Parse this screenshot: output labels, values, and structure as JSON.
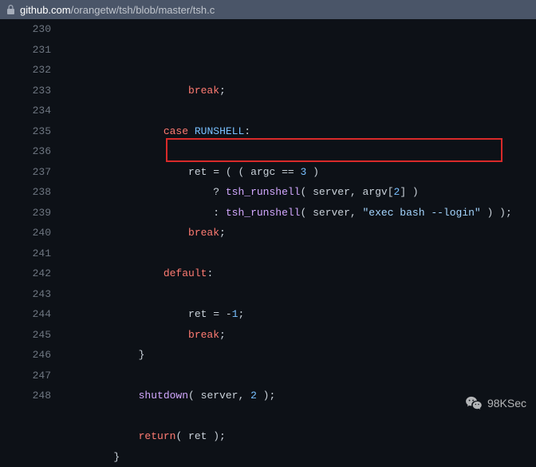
{
  "url": {
    "host": "github.com",
    "path": "/orangetw/tsh/blob/master/tsh.c"
  },
  "watermark": {
    "label": "98KSec"
  },
  "gutter": {
    "start": 230,
    "end": 248
  },
  "code": {
    "lines": [
      {
        "n": 230,
        "indent": 20,
        "tokens": [
          {
            "t": "kw",
            "v": "break"
          },
          {
            "t": "punct",
            "v": ";"
          }
        ]
      },
      {
        "n": 231,
        "indent": 0,
        "tokens": []
      },
      {
        "n": 232,
        "indent": 16,
        "tokens": [
          {
            "t": "kw",
            "v": "case"
          },
          {
            "t": "txt",
            "v": " "
          },
          {
            "t": "const",
            "v": "RUNSHELL"
          },
          {
            "t": "punct",
            "v": ":"
          }
        ]
      },
      {
        "n": 233,
        "indent": 0,
        "tokens": []
      },
      {
        "n": 234,
        "indent": 20,
        "tokens": [
          {
            "t": "txt",
            "v": "ret "
          },
          {
            "t": "op",
            "v": "="
          },
          {
            "t": "txt",
            "v": " ( ( argc "
          },
          {
            "t": "op",
            "v": "=="
          },
          {
            "t": "txt",
            "v": " "
          },
          {
            "t": "num",
            "v": "3"
          },
          {
            "t": "txt",
            "v": " )"
          }
        ]
      },
      {
        "n": 235,
        "indent": 24,
        "tokens": [
          {
            "t": "op",
            "v": "?"
          },
          {
            "t": "txt",
            "v": " "
          },
          {
            "t": "fn",
            "v": "tsh_runshell"
          },
          {
            "t": "txt",
            "v": "( server, argv["
          },
          {
            "t": "num",
            "v": "2"
          },
          {
            "t": "txt",
            "v": "] )"
          }
        ]
      },
      {
        "n": 236,
        "indent": 24,
        "tokens": [
          {
            "t": "op",
            "v": ":"
          },
          {
            "t": "txt",
            "v": " "
          },
          {
            "t": "fn",
            "v": "tsh_runshell"
          },
          {
            "t": "txt",
            "v": "( server, "
          },
          {
            "t": "str",
            "v": "\"exec bash --login\""
          },
          {
            "t": "txt",
            "v": " ) );"
          }
        ]
      },
      {
        "n": 237,
        "indent": 20,
        "tokens": [
          {
            "t": "kw",
            "v": "break"
          },
          {
            "t": "punct",
            "v": ";"
          }
        ]
      },
      {
        "n": 238,
        "indent": 0,
        "tokens": []
      },
      {
        "n": 239,
        "indent": 16,
        "tokens": [
          {
            "t": "kw",
            "v": "default"
          },
          {
            "t": "punct",
            "v": ":"
          }
        ]
      },
      {
        "n": 240,
        "indent": 0,
        "tokens": []
      },
      {
        "n": 241,
        "indent": 20,
        "tokens": [
          {
            "t": "txt",
            "v": "ret "
          },
          {
            "t": "op",
            "v": "="
          },
          {
            "t": "txt",
            "v": " "
          },
          {
            "t": "op",
            "v": "-"
          },
          {
            "t": "num",
            "v": "1"
          },
          {
            "t": "punct",
            "v": ";"
          }
        ]
      },
      {
        "n": 242,
        "indent": 20,
        "tokens": [
          {
            "t": "kw",
            "v": "break"
          },
          {
            "t": "punct",
            "v": ";"
          }
        ]
      },
      {
        "n": 243,
        "indent": 12,
        "tokens": [
          {
            "t": "punct",
            "v": "}"
          }
        ]
      },
      {
        "n": 244,
        "indent": 0,
        "tokens": []
      },
      {
        "n": 245,
        "indent": 12,
        "tokens": [
          {
            "t": "fn",
            "v": "shutdown"
          },
          {
            "t": "txt",
            "v": "( server, "
          },
          {
            "t": "num",
            "v": "2"
          },
          {
            "t": "txt",
            "v": " );"
          }
        ]
      },
      {
        "n": 246,
        "indent": 0,
        "tokens": []
      },
      {
        "n": 247,
        "indent": 12,
        "tokens": [
          {
            "t": "kw",
            "v": "return"
          },
          {
            "t": "txt",
            "v": "( ret );"
          }
        ]
      },
      {
        "n": 248,
        "indent": 8,
        "tokens": [
          {
            "t": "punct",
            "v": "}"
          }
        ]
      }
    ]
  }
}
